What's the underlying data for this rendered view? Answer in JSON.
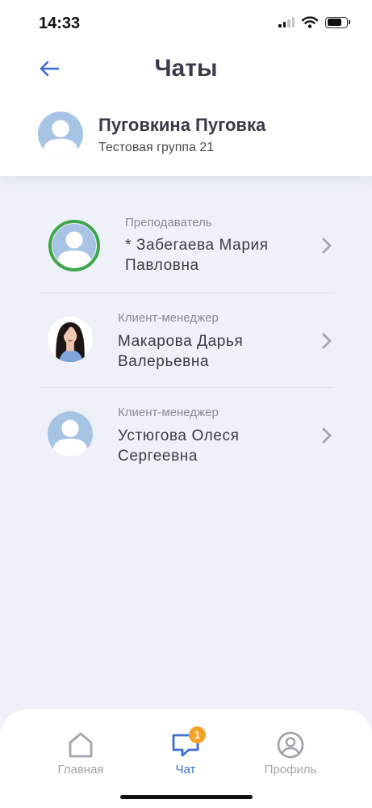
{
  "status_bar": {
    "time": "14:33",
    "battery_level": 0.78,
    "signal_bars_active": 2,
    "signal_bars_total": 4
  },
  "header": {
    "title": "Чаты",
    "back_icon": "arrow-left-icon"
  },
  "user": {
    "name": "Пуговкина Пуговка",
    "group": "Тестовая группа 21",
    "avatar_icon": "user-placeholder-icon"
  },
  "chats": [
    {
      "role": "Преподаватель",
      "name_line1": "* Забегаева Мария",
      "name_line2": "Павловна",
      "avatar": "user-placeholder-icon",
      "online": true
    },
    {
      "role": "Клиент-менеджер",
      "name_line1": "Макарова Дарья",
      "name_line2": "Валерьевна",
      "avatar": "photo-portrait",
      "online": false
    },
    {
      "role": "Клиент-менеджер",
      "name_line1": "Устюгова Олеся",
      "name_line2": "Сергеевна",
      "avatar": "user-placeholder-icon",
      "online": false
    }
  ],
  "tabs": [
    {
      "label": "Главная",
      "icon": "home-icon",
      "active": false
    },
    {
      "label": "Чат",
      "icon": "chat-icon",
      "active": true,
      "badge": "1"
    },
    {
      "label": "Профиль",
      "icon": "profile-icon",
      "active": false
    }
  ],
  "colors": {
    "accent": "#3d6dd6",
    "online_ring": "#3fa64a",
    "avatar_bg": "#a8c4e5",
    "badge": "#f1a22a",
    "background": "#eef1f8"
  }
}
